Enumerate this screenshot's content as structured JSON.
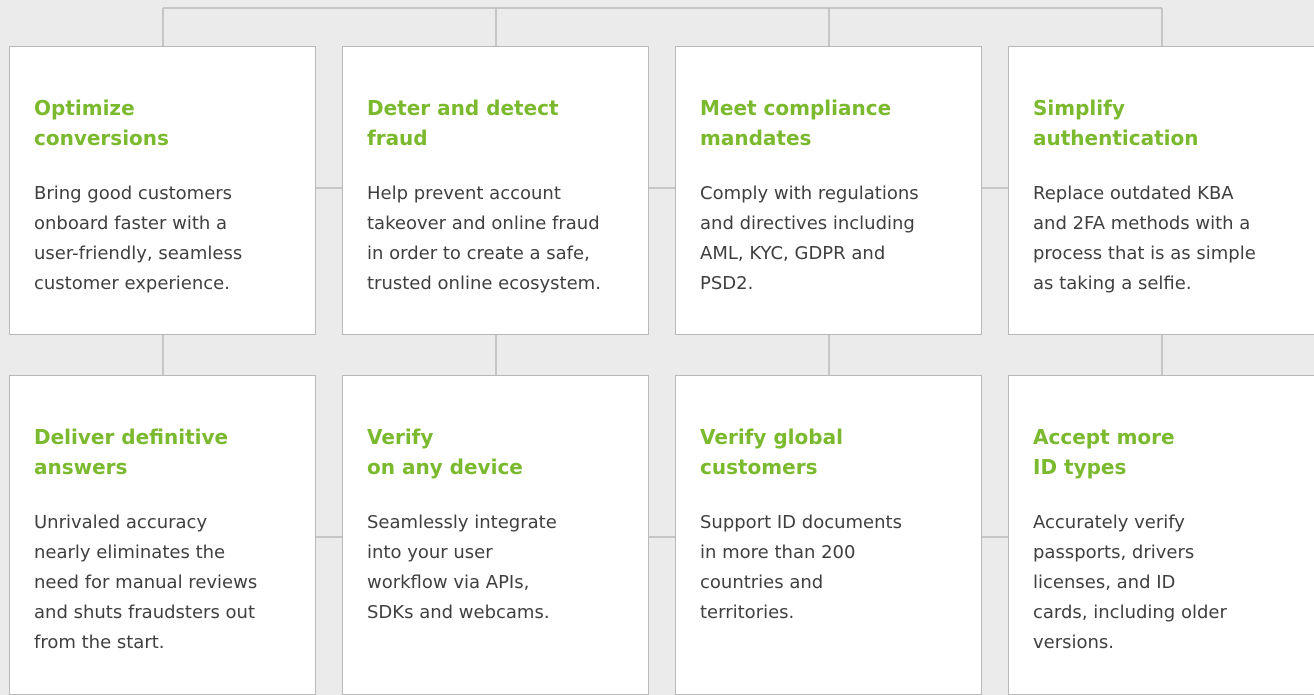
{
  "theme": {
    "accent_color": "#7bb92f",
    "text_color": "#3f3f3f",
    "background_color": "#ebebeb",
    "card_color": "#ffffff",
    "line_color": "#b9b9b9"
  },
  "rows": [
    {
      "cards": [
        {
          "title": "Optimize\nconversions",
          "body": "Bring good customers\nonboard faster with a\nuser-friendly, seamless\ncustomer experience."
        },
        {
          "title": "Deter and detect\nfraud",
          "body": "Help prevent account\ntakeover and online fraud\nin order to create a safe,\ntrusted online ecosystem."
        },
        {
          "title": "Meet compliance\nmandates",
          "body": "Comply with regulations\nand directives including\nAML, KYC, GDPR and\nPSD2."
        },
        {
          "title": "Simplify\nauthentication",
          "body": "Replace outdated KBA\nand 2FA methods with a\nprocess that is as simple\nas taking a selfie."
        }
      ]
    },
    {
      "cards": [
        {
          "title": "Deliver definitive\nanswers",
          "body": "Unrivaled accuracy\nnearly eliminates the\nneed for manual reviews\nand shuts fraudsters out\nfrom the start."
        },
        {
          "title": "Verify\non any device",
          "body": "Seamlessly integrate\ninto your user\nworkflow via APIs,\nSDKs and webcams."
        },
        {
          "title": "Verify global\ncustomers",
          "body": "Support ID documents\nin more than 200\ncountries and\nterritories."
        },
        {
          "title": "Accept more\nID types",
          "body": "Accurately verify\npassports, drivers\nlicenses, and ID\ncards, including older\nversions."
        }
      ]
    }
  ]
}
